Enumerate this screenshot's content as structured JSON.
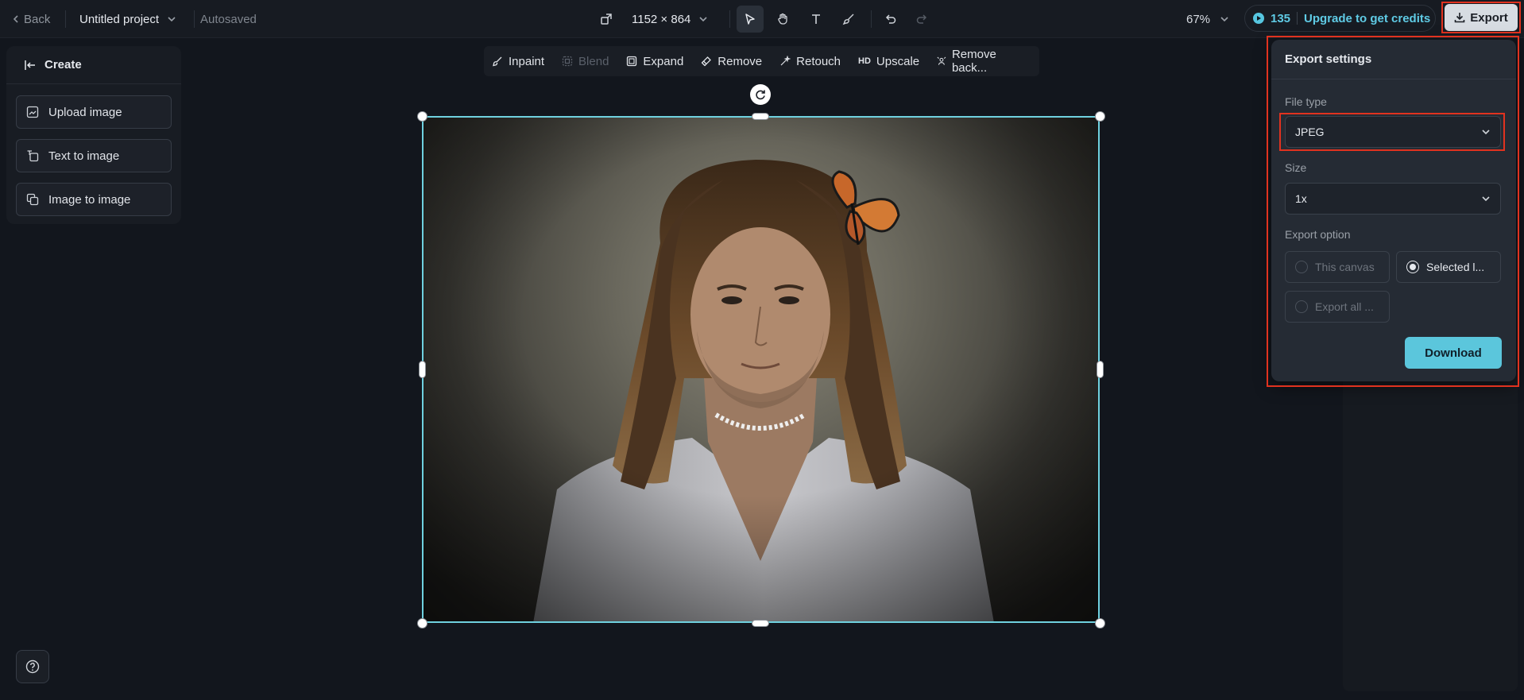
{
  "topbar": {
    "back_label": "Back",
    "project_name": "Untitled project",
    "autosaved": "Autosaved",
    "canvas_size": "1152 × 864",
    "zoom": "67%",
    "credits": "135",
    "upgrade_label": "Upgrade to get credits",
    "export_label": "Export"
  },
  "left_panel": {
    "header": "Create",
    "buttons": [
      {
        "label": "Upload image",
        "icon": "upload-image-icon"
      },
      {
        "label": "Text to image",
        "icon": "text-to-image-icon"
      },
      {
        "label": "Image to image",
        "icon": "image-to-image-icon"
      }
    ]
  },
  "edit_toolbar": {
    "items": [
      {
        "label": "Inpaint",
        "icon": "inpaint-icon",
        "disabled": false
      },
      {
        "label": "Blend",
        "icon": "blend-icon",
        "disabled": true
      },
      {
        "label": "Expand",
        "icon": "expand-icon",
        "disabled": false
      },
      {
        "label": "Remove",
        "icon": "eraser-icon",
        "disabled": false
      },
      {
        "label": "Retouch",
        "icon": "retouch-icon",
        "disabled": false
      },
      {
        "label": "Upscale",
        "icon": "hd-icon",
        "disabled": false
      },
      {
        "label": "Remove back...",
        "icon": "remove-background-icon",
        "disabled": false
      }
    ]
  },
  "export_panel": {
    "title": "Export settings",
    "file_type_label": "File type",
    "file_type_value": "JPEG",
    "size_label": "Size",
    "size_value": "1x",
    "export_option_label": "Export option",
    "options": [
      {
        "label": "This canvas",
        "selected": false
      },
      {
        "label": "Selected l...",
        "selected": true
      },
      {
        "label": "Export all ...",
        "selected": false
      }
    ],
    "download_label": "Download"
  },
  "colors": {
    "accent": "#5bc6dc",
    "highlight": "#e1321f",
    "selection": "#6fd1df"
  }
}
